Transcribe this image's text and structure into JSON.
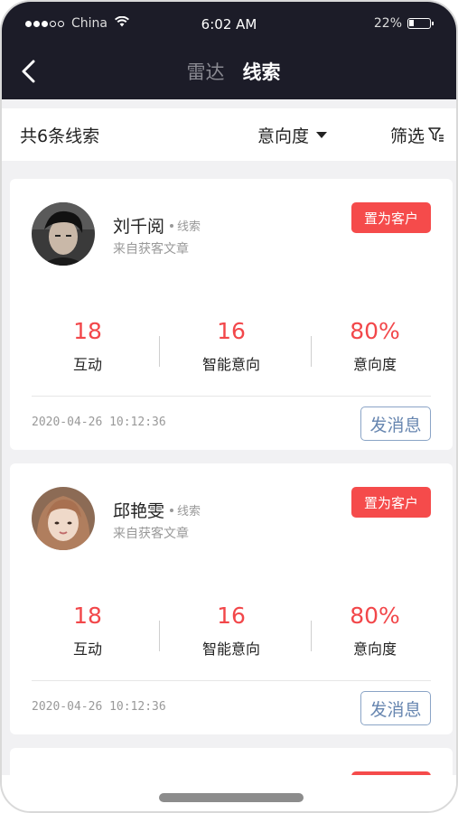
{
  "status_bar": {
    "carrier": "China",
    "time": "6:02 AM",
    "battery_percent": "22%",
    "battery_level": 0.22
  },
  "nav": {
    "tabs": [
      {
        "label": "雷达",
        "active": false
      },
      {
        "label": "线索",
        "active": true
      }
    ]
  },
  "filter_bar": {
    "count_label": "共6条线索",
    "intent_label": "意向度",
    "filter_label": "筛选"
  },
  "leads": [
    {
      "name": "刘千阅",
      "tag": "线索",
      "source": "来自获客文章",
      "action_label": "置为客户",
      "stats": [
        {
          "value": "18",
          "label": "互动"
        },
        {
          "value": "16",
          "label": "智能意向"
        },
        {
          "value": "80%",
          "label": "意向度"
        }
      ],
      "datetime": "2020-04-26  10:12:36",
      "message_label": "发消息"
    },
    {
      "name": "邱艳雯",
      "tag": "线索",
      "source": "来自获客文章",
      "action_label": "置为客户",
      "stats": [
        {
          "value": "18",
          "label": "互动"
        },
        {
          "value": "16",
          "label": "智能意向"
        },
        {
          "value": "80%",
          "label": "意向度"
        }
      ],
      "datetime": "2020-04-26  10:12:36",
      "message_label": "发消息"
    }
  ],
  "colors": {
    "header_bg": "#1c1c28",
    "accent_red": "#f54b4b",
    "stat_red": "#f2474a",
    "message_blue": "#6786b0"
  },
  "icons": [
    "back-arrow-icon",
    "wifi-icon",
    "battery-icon",
    "caret-down-icon",
    "filter-funnel-icon"
  ]
}
